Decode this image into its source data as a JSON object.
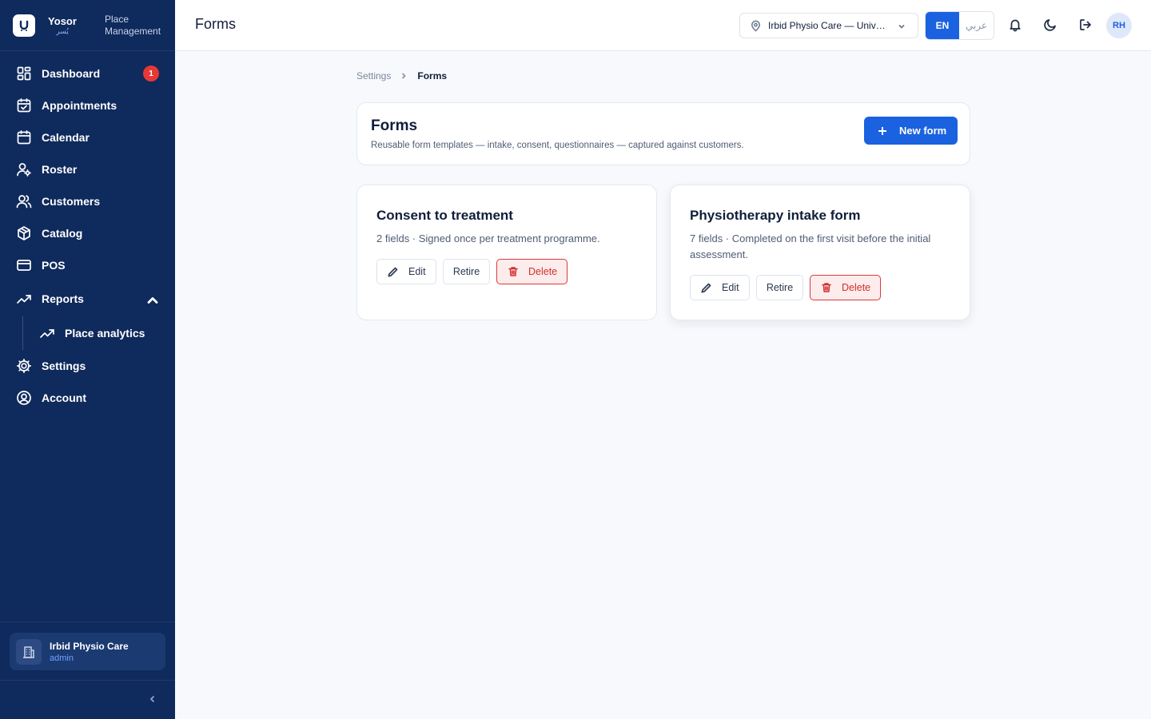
{
  "brand": {
    "name": "Yosor",
    "name_ar": "يُسر",
    "subtitle": "Place Management"
  },
  "sidebar": {
    "items": [
      {
        "label": "Dashboard",
        "icon": "dashboard-icon",
        "badge": "1"
      },
      {
        "label": "Appointments",
        "icon": "calendar-check-icon"
      },
      {
        "label": "Calendar",
        "icon": "calendar-icon"
      },
      {
        "label": "Roster",
        "icon": "user-gear-icon"
      },
      {
        "label": "Customers",
        "icon": "users-icon"
      },
      {
        "label": "Catalog",
        "icon": "package-icon"
      },
      {
        "label": "POS",
        "icon": "credit-card-icon"
      },
      {
        "label": "Reports",
        "icon": "trending-up-icon",
        "expanded": true
      },
      {
        "label": "Place analytics",
        "icon": "trending-up-icon"
      },
      {
        "label": "Settings",
        "icon": "gear-icon"
      },
      {
        "label": "Account",
        "icon": "user-circle-icon"
      }
    ],
    "place": {
      "name": "Irbid Physio Care",
      "role": "admin"
    }
  },
  "header": {
    "title": "Forms",
    "place_select": "Irbid Physio Care — University Branch",
    "lang_en": "EN",
    "lang_ar": "عربي",
    "avatar": "RH"
  },
  "breadcrumb": {
    "parent": "Settings",
    "current": "Forms"
  },
  "hero": {
    "title": "Forms",
    "subtitle": "Reusable form templates — intake, consent, questionnaires — captured against customers.",
    "new_button": "New form"
  },
  "forms": [
    {
      "title": "Consent to treatment",
      "description": "2 fields · Signed once per treatment programme.",
      "edit": "Edit",
      "retire": "Retire",
      "delete": "Delete"
    },
    {
      "title": "Physiotherapy intake form",
      "description": "7 fields · Completed on the first visit before the initial assessment.",
      "edit": "Edit",
      "retire": "Retire",
      "delete": "Delete"
    }
  ],
  "colors": {
    "sidebar": "#0f2a5c",
    "accent": "#1a62e0",
    "danger": "#d32f2f",
    "badge": "#e53935"
  }
}
